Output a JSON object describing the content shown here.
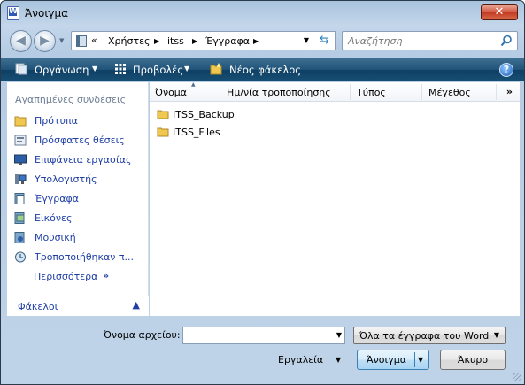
{
  "window": {
    "title": "Άνοιγμα",
    "close_label": "✕"
  },
  "address": {
    "chevron": "«",
    "crumbs": [
      "Χρήστες",
      "itss",
      "Έγγραφα"
    ]
  },
  "search": {
    "placeholder": "Αναζήτηση"
  },
  "toolbar": {
    "organize_label": "Οργάνωση",
    "views_label": "Προβολές",
    "new_folder_label": "Νέος φάκελος",
    "help_label": "?"
  },
  "navpane": {
    "favorites_heading": "Αγαπημένες συνδέσεις",
    "favorites": [
      {
        "label": "Πρότυπα",
        "icon": "folder-icon"
      },
      {
        "label": "Πρόσφατες θέσεις",
        "icon": "recent-places-icon"
      },
      {
        "label": "Επιφάνεια εργασίας",
        "icon": "desktop-icon"
      },
      {
        "label": "Υπολογιστής",
        "icon": "computer-icon"
      },
      {
        "label": "Έγγραφα",
        "icon": "documents-icon"
      },
      {
        "label": "Εικόνες",
        "icon": "pictures-icon"
      },
      {
        "label": "Μουσική",
        "icon": "music-icon"
      },
      {
        "label": "Τροποποιήθηκαν π...",
        "icon": "recently-changed-icon"
      }
    ],
    "more_label": "Περισσότερα",
    "more_arrow": "»",
    "folders_label": "Φάκελοι",
    "folders_chevron": "⌃"
  },
  "filelist": {
    "columns": [
      "Όνομα",
      "Ημ/νία τροποποίησης",
      "Τύπος",
      "Μέγεθος"
    ],
    "more_columns": "»",
    "files": [
      {
        "name": "ITSS_Backup",
        "icon": "folder-icon"
      },
      {
        "name": "ITSS_Files",
        "icon": "folder-icon"
      }
    ]
  },
  "bottom": {
    "filename_label": "Όνομα αρχείου:",
    "filename_value": "",
    "filetype_value": "Όλα τα έγγραφα του Word",
    "tools_label": "Εργαλεία",
    "open_label": "Άνοιγμα",
    "cancel_label": "Άκυρο"
  },
  "colors": {
    "toolbar": "#1f5278",
    "link": "#1e3ea5",
    "folder": "#e8b84a"
  }
}
